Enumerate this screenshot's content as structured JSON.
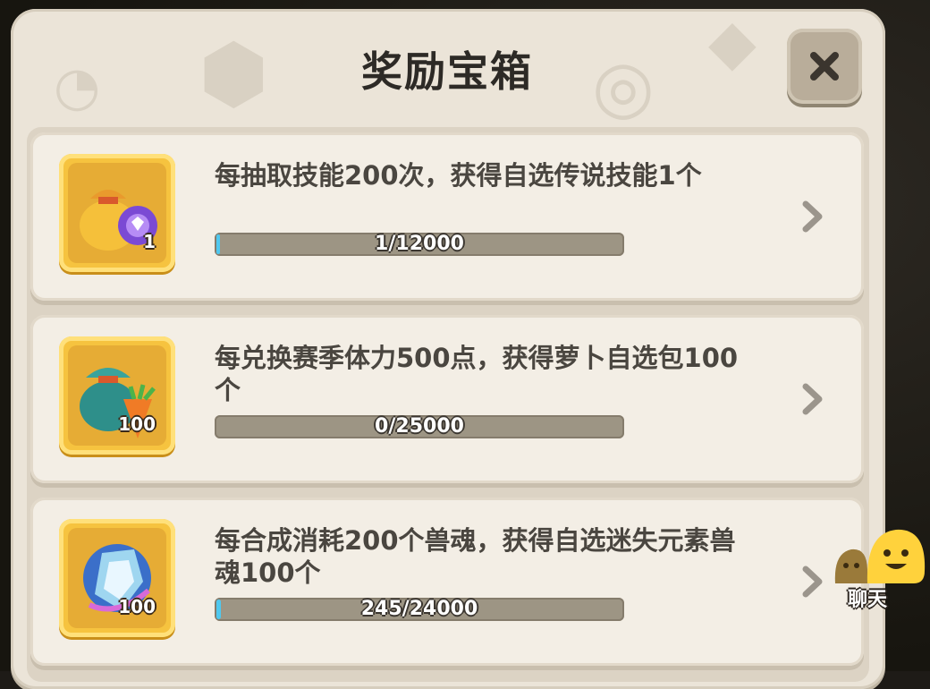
{
  "title": "奖励宝箱",
  "close_icon": "close-icon",
  "rewards": [
    {
      "description": "每抽取技能200次，获得自选传说技能1个",
      "quantity": "1",
      "progress_text": "1/12000",
      "progress": 0.0001,
      "icon": "skill-bag-icon"
    },
    {
      "description": "每兑换赛季体力500点，获得萝卜自选包100个",
      "quantity": "100",
      "progress_text": "0/25000",
      "progress": 0,
      "icon": "carrot-bag-icon"
    },
    {
      "description": "每合成消耗200个兽魂，获得自选迷失元素兽魂100个",
      "quantity": "100",
      "progress_text": "245/24000",
      "progress": 0.0102,
      "icon": "crystal-soul-icon"
    }
  ],
  "chat": {
    "label": "聊天",
    "icon": "chat-blob-icon"
  },
  "colors": {
    "progress_fill": "#4fc8ef",
    "icon_frame": "#f6c33f"
  }
}
